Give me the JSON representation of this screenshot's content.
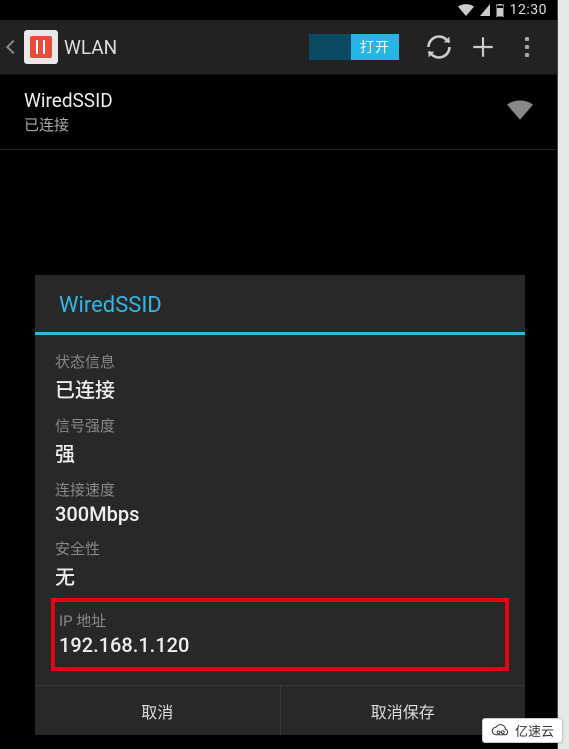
{
  "status_bar": {
    "time": "12:30"
  },
  "action_bar": {
    "title": "WLAN",
    "toggle_label": "打开"
  },
  "network": {
    "ssid": "WiredSSID",
    "status": "已连接"
  },
  "dialog": {
    "title": "WiredSSID",
    "fields": {
      "state_label": "状态信息",
      "state_value": "已连接",
      "signal_label": "信号强度",
      "signal_value": "强",
      "speed_label": "连接速度",
      "speed_value": "300Mbps",
      "security_label": "安全性",
      "security_value": "无",
      "ip_label": "IP 地址",
      "ip_value": "192.168.1.120"
    },
    "cancel_label": "取消",
    "forget_label": "取消保存"
  },
  "watermark": {
    "text": "亿速云"
  }
}
